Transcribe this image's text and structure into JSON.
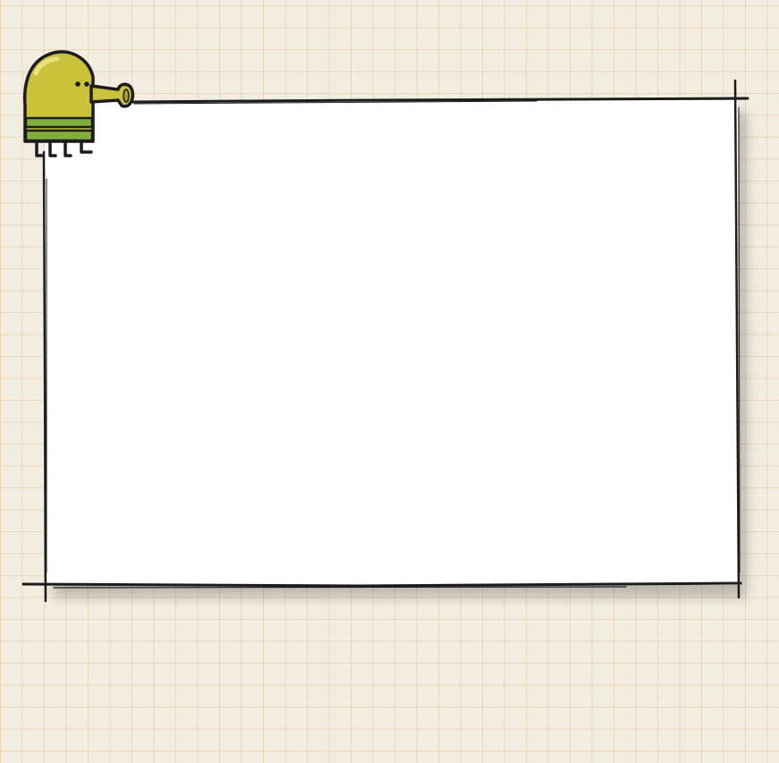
{
  "scene": {
    "background": "graph-paper",
    "grid_color": "#dec4a0",
    "paper_color": "#f3ece0",
    "panel_color": "#ffffff",
    "panel_content": ""
  },
  "character": {
    "name": "doodler",
    "body_color": "#c9c23a",
    "stripe_color": "#7fae3f"
  }
}
